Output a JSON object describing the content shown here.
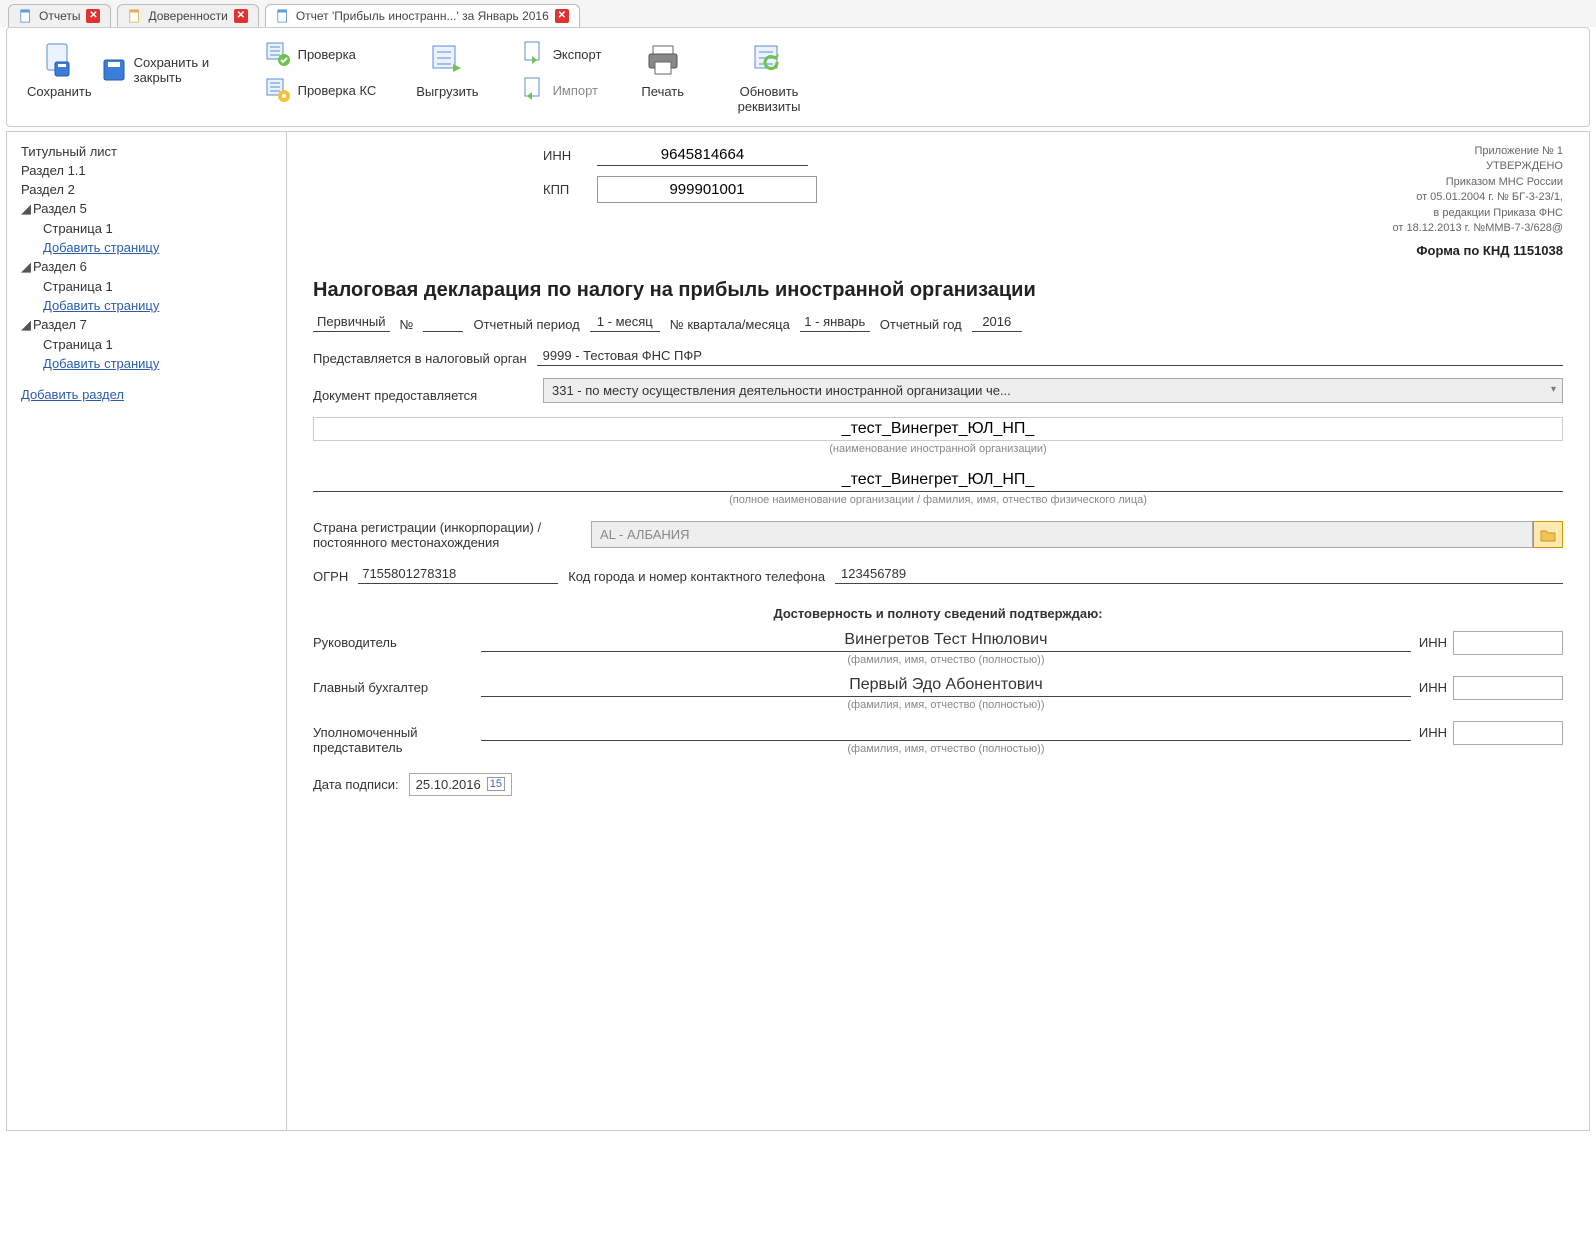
{
  "tabs": [
    {
      "label": "Отчеты"
    },
    {
      "label": "Доверенности"
    },
    {
      "label": "Отчет 'Прибыль иностранн...' за Январь 2016"
    }
  ],
  "toolbar": {
    "save": "Сохранить",
    "save_close": "Сохранить и закрыть",
    "check": "Проверка",
    "check_ks": "Проверка КС",
    "upload": "Выгрузить",
    "export": "Экспорт",
    "import": "Импорт",
    "print": "Печать",
    "refresh": "Обновить реквизиты"
  },
  "tree": {
    "title_page": "Титульный лист",
    "s11": "Раздел 1.1",
    "s2": "Раздел 2",
    "s5": "Раздел 5",
    "s6": "Раздел 6",
    "s7": "Раздел 7",
    "page1": "Страница 1",
    "add_page": "Добавить страницу",
    "add_section": "Добавить раздел"
  },
  "header": {
    "inn_label": "ИНН",
    "inn_value": "9645814664",
    "kpp_label": "КПП",
    "kpp_value": "999901001",
    "appendix": "Приложение № 1",
    "approved": "УТВЕРЖДЕНО",
    "l1": "Приказом МНС России",
    "l2": "от 05.01.2004 г. № БГ-3-23/1,",
    "l3": "в редакции Приказа ФНС",
    "l4": "от 18.12.2013 г. №ММВ-7-3/628@",
    "form_code": "Форма по КНД 1151038"
  },
  "title": "Налоговая декларация по налогу на прибыль иностранной организации",
  "meta": {
    "primary_label": "Первичный",
    "num_label": "№",
    "num_value": "",
    "period_label": "Отчетный период",
    "period_value": "1 - месяц",
    "quarter_label": "№ квартала/месяца",
    "quarter_value": "1 - январь",
    "year_label": "Отчетный год",
    "year_value": "2016",
    "submit_label": "Представляется в налоговый орган",
    "submit_value": "9999 - Тестовая ФНС ПФР",
    "doc_label": "Документ предоставляется",
    "doc_value": "331 - по месту осуществления деятельности иностранной организации че..."
  },
  "org": {
    "name1": "_тест_Винегрет_ЮЛ_НП_",
    "hint1": "(наименование иностранной организации)",
    "name2": "_тест_Винегрет_ЮЛ_НП_",
    "hint2": "(полное наименование организации / фамилия, имя, отчество физического лица)",
    "country_label": "Страна регистрации (инкорпорации) / постоянного местонахождения",
    "country_value": "AL - АЛБАНИЯ",
    "ogrn_label": "ОГРН",
    "ogrn_value": "7155801278318",
    "phone_label": "Код города и номер контактного телефона",
    "phone_value": "123456789"
  },
  "sign": {
    "title": "Достоверность и полноту сведений подтверждаю:",
    "head_role": "Руководитель",
    "head_name": "Винегретов Тест Нпюлович",
    "acc_role": "Главный бухгалтер",
    "acc_name": "Первый Эдо Абонентович",
    "rep_role": "Уполномоченный представитель",
    "rep_name": "",
    "fio_hint": "(фамилия, имя, отчество (полностью))",
    "inn_label": "ИНН",
    "date_label": "Дата подписи:",
    "date_value": "25.10.2016"
  }
}
